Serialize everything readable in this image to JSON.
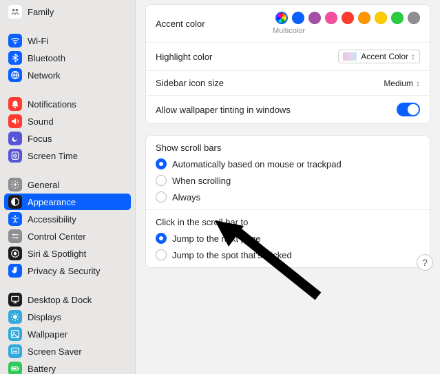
{
  "sidebar": {
    "groups": [
      [
        {
          "key": "family",
          "label": "Family",
          "icon": "family",
          "bg": "#ffffff",
          "fg": "#7b7b7f"
        }
      ],
      [
        {
          "key": "wifi",
          "label": "Wi-Fi",
          "icon": "wifi",
          "bg": "#0a60ff",
          "fg": "#fff"
        },
        {
          "key": "bluetooth",
          "label": "Bluetooth",
          "icon": "bluetooth",
          "bg": "#0a60ff",
          "fg": "#fff"
        },
        {
          "key": "network",
          "label": "Network",
          "icon": "network",
          "bg": "#0a60ff",
          "fg": "#fff"
        }
      ],
      [
        {
          "key": "notifications",
          "label": "Notifications",
          "icon": "bell",
          "bg": "#ff3b30",
          "fg": "#fff"
        },
        {
          "key": "sound",
          "label": "Sound",
          "icon": "sound",
          "bg": "#ff3b30",
          "fg": "#fff"
        },
        {
          "key": "focus",
          "label": "Focus",
          "icon": "focus",
          "bg": "#5856d6",
          "fg": "#fff"
        },
        {
          "key": "screentime",
          "label": "Screen Time",
          "icon": "screentime",
          "bg": "#5856d6",
          "fg": "#fff"
        }
      ],
      [
        {
          "key": "general",
          "label": "General",
          "icon": "gear",
          "bg": "#8e8e93",
          "fg": "#fff"
        },
        {
          "key": "appearance",
          "label": "Appearance",
          "icon": "appearance",
          "bg": "#1c1c1e",
          "fg": "#fff",
          "selected": true
        },
        {
          "key": "accessibility",
          "label": "Accessibility",
          "icon": "accessibility",
          "bg": "#0a60ff",
          "fg": "#fff"
        },
        {
          "key": "controlcenter",
          "label": "Control Center",
          "icon": "controlcenter",
          "bg": "#8e8e93",
          "fg": "#fff"
        },
        {
          "key": "siri",
          "label": "Siri & Spotlight",
          "icon": "siri",
          "bg": "#1c1c1e",
          "fg": "#fff"
        },
        {
          "key": "privacy",
          "label": "Privacy & Security",
          "icon": "hand",
          "bg": "#0a60ff",
          "fg": "#fff"
        }
      ],
      [
        {
          "key": "desktop",
          "label": "Desktop & Dock",
          "icon": "desktop",
          "bg": "#1c1c1e",
          "fg": "#fff"
        },
        {
          "key": "displays",
          "label": "Displays",
          "icon": "displays",
          "bg": "#34aadc",
          "fg": "#fff"
        },
        {
          "key": "wallpaper",
          "label": "Wallpaper",
          "icon": "wallpaper",
          "bg": "#34aadc",
          "fg": "#fff"
        },
        {
          "key": "screensaver",
          "label": "Screen Saver",
          "icon": "screensaver",
          "bg": "#34aadc",
          "fg": "#fff"
        },
        {
          "key": "battery",
          "label": "Battery",
          "icon": "battery",
          "bg": "#34c759",
          "fg": "#fff"
        }
      ]
    ]
  },
  "appearance": {
    "accent": {
      "label": "Accent color",
      "caption": "Multicolor",
      "colors": [
        "multi",
        "#0a60ff",
        "#a550a7",
        "#f74f9e",
        "#ff3b30",
        "#ff9500",
        "#ffcc00",
        "#28cd41",
        "#8e8e93"
      ],
      "selected": 0
    },
    "highlight": {
      "label": "Highlight color",
      "value": "Accent Color"
    },
    "sidebar_size": {
      "label": "Sidebar icon size",
      "value": "Medium"
    },
    "tinting": {
      "label": "Allow wallpaper tinting in windows",
      "value": true
    },
    "scroll": {
      "title": "Show scroll bars",
      "options": [
        "Automatically based on mouse or trackpad",
        "When scrolling",
        "Always"
      ],
      "selected": 0
    },
    "click": {
      "title": "Click in the scroll bar to",
      "options": [
        "Jump to the next page",
        "Jump to the spot that's clicked"
      ],
      "selected": 0
    }
  },
  "help_label": "?"
}
